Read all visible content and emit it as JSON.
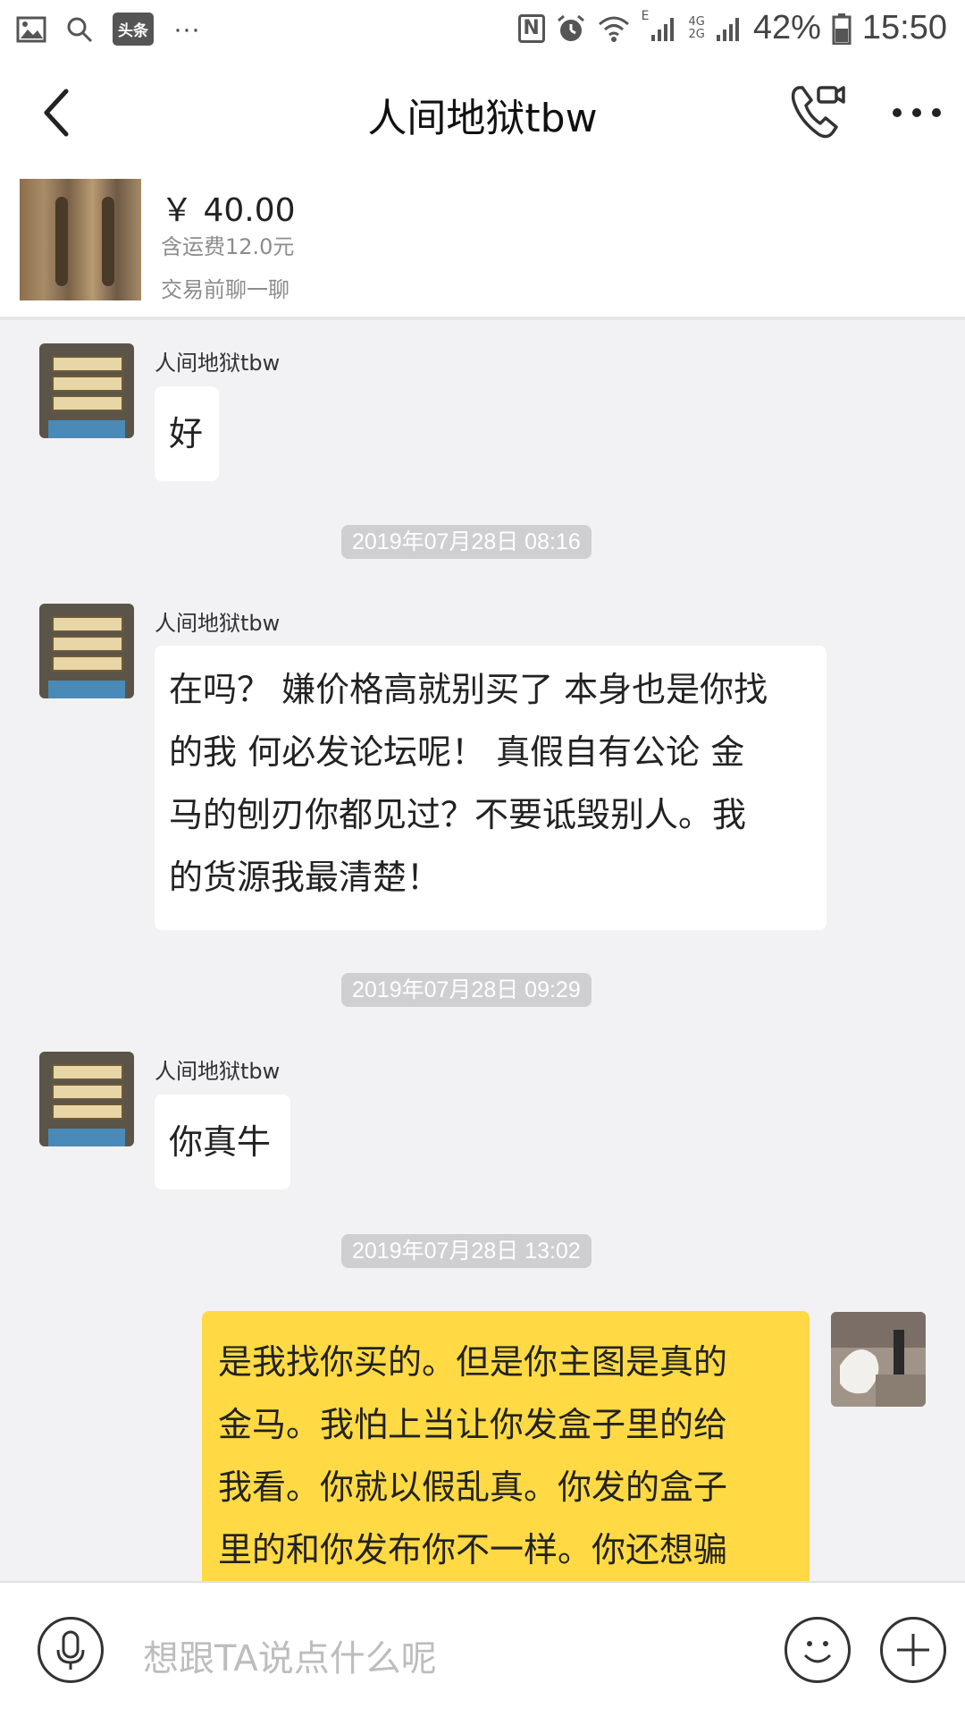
{
  "status_bar": {
    "toutiao_label": "头条",
    "dots": "···",
    "nfc": "N",
    "net_e": "E",
    "net_4g": "4G",
    "net_2g": "2G",
    "battery": "42%",
    "time": "15:50"
  },
  "nav": {
    "title": "人间地狱tbw"
  },
  "product": {
    "price": "￥ 40.00",
    "shipping": "含运费12.0元",
    "chat_hint": "交易前聊一聊"
  },
  "messages": [
    {
      "sender": "人间地狱tbw",
      "text": "好"
    },
    {
      "timestamp": "2019年07月28日 08:16"
    },
    {
      "sender": "人间地狱tbw",
      "lines": [
        "在吗？ 嫌价格高就别买了 本身也是你找",
        "的我 何必发论坛呢！ 真假自有公论 金",
        "马的刨刃你都见过？不要诋毁别人。我",
        "的货源我最清楚！"
      ]
    },
    {
      "timestamp": "2019年07月28日 09:29"
    },
    {
      "sender": "人间地狱tbw",
      "text": "你真牛"
    },
    {
      "timestamp": "2019年07月28日 13:02"
    },
    {
      "mine": true,
      "lines": [
        "是我找你买的。但是你主图是真的",
        "金马。我怕上当让你发盒子里的给",
        "我看。你就以假乱真。你发的盒子",
        "里的和你发布你不一样。你还想骗"
      ]
    }
  ],
  "input": {
    "placeholder": "想跟TA说点什么呢"
  },
  "colors": {
    "my_bubble": "#ffda44",
    "chat_bg": "#f2f2f4"
  }
}
